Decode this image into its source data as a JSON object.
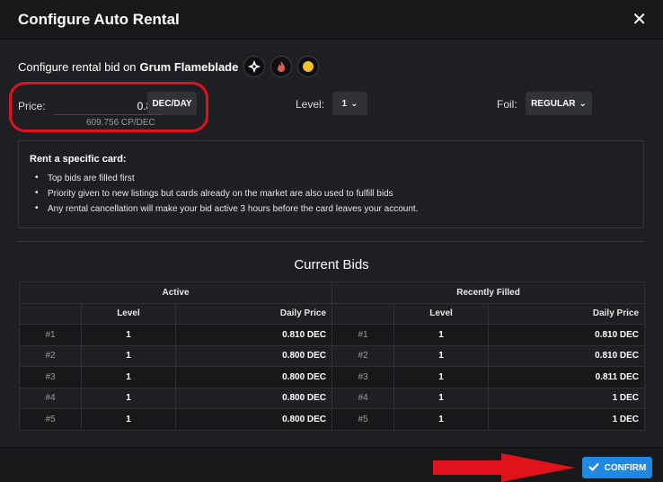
{
  "header": {
    "title": "Configure Auto Rental"
  },
  "card": {
    "prefix": "Configure rental bid on",
    "name": "Grum Flameblade",
    "icons": [
      "element-neutral-icon",
      "fire-splinter-icon",
      "gold-foil-icon"
    ]
  },
  "price": {
    "label": "Price:",
    "value": "0.82",
    "unit_button": "DEC/DAY",
    "cp_text": "609.756 CP/DEC"
  },
  "level": {
    "label": "Level:",
    "value": "1"
  },
  "foil": {
    "label": "Foil:",
    "value": "REGULAR"
  },
  "info": {
    "title": "Rent a specific card:",
    "bullets": [
      "Top bids are filled first",
      "Priority given to new listings but cards already on the market are also used to fulfill bids",
      "Any rental cancellation will make your bid active 3 hours before the card leaves your account."
    ]
  },
  "bids": {
    "title": "Current Bids",
    "active_header": "Active",
    "filled_header": "Recently Filled",
    "col_level": "Level",
    "col_price": "Daily Price",
    "active": [
      {
        "rank": "#1",
        "level": "1",
        "price": "0.810 DEC"
      },
      {
        "rank": "#2",
        "level": "1",
        "price": "0.800 DEC"
      },
      {
        "rank": "#3",
        "level": "1",
        "price": "0.800 DEC"
      },
      {
        "rank": "#4",
        "level": "1",
        "price": "0.800 DEC"
      },
      {
        "rank": "#5",
        "level": "1",
        "price": "0.800 DEC"
      }
    ],
    "filled": [
      {
        "rank": "#1",
        "level": "1",
        "price": "0.810 DEC"
      },
      {
        "rank": "#2",
        "level": "1",
        "price": "0.810 DEC"
      },
      {
        "rank": "#3",
        "level": "1",
        "price": "0.811 DEC"
      },
      {
        "rank": "#4",
        "level": "1",
        "price": "1 DEC"
      },
      {
        "rank": "#5",
        "level": "1",
        "price": "1 DEC"
      }
    ]
  },
  "footer": {
    "confirm_label": "CONFIRM"
  },
  "colors": {
    "accent": "#1e88e5",
    "highlight": "#e0121b",
    "background": "#1e1f22"
  }
}
